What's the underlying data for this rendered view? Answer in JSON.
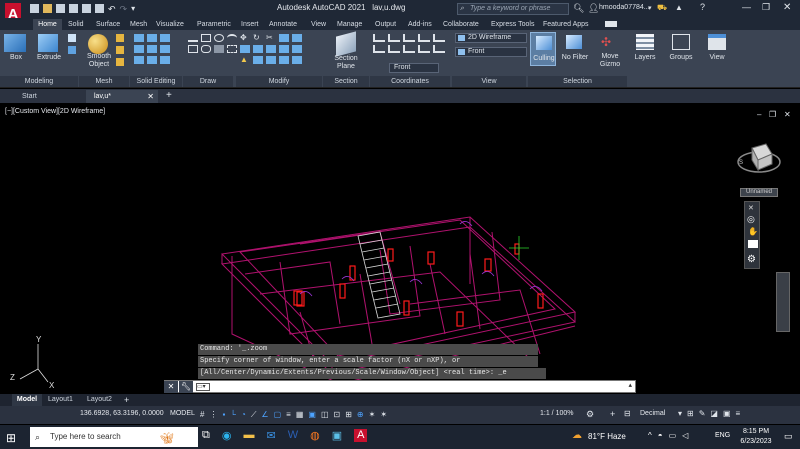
{
  "app": {
    "title": "Autodesk AutoCAD 2021",
    "file": "lav,u.dwg",
    "search_placeholder": "Type a keyword or phrase",
    "user": "hmooda07784...",
    "logo_letter": "A"
  },
  "ribbon": {
    "tabs": [
      "Home",
      "Solid",
      "Surface",
      "Mesh",
      "Visualize",
      "Parametric",
      "Insert",
      "Annotate",
      "View",
      "Manage",
      "Output",
      "Add-ins",
      "Collaborate",
      "Express Tools",
      "Featured Apps"
    ],
    "active_tab": "Home",
    "panels": {
      "modeling": "Modeling",
      "mesh": "Mesh",
      "solid_editing": "Solid Editing",
      "draw": "Draw",
      "modify": "Modify",
      "section": "Section",
      "coordinates": "Coordinates",
      "view": "View",
      "selection": "Selection"
    },
    "buttons": {
      "box": "Box",
      "extrude": "Extrude",
      "smooth_object": "Smooth Object",
      "section_plane": "Section Plane",
      "culling": "Culling",
      "no_filter": "No Filter",
      "move_gizmo": "Move Gizmo",
      "layers": "Layers",
      "groups": "Groups",
      "view": "View"
    },
    "visual_style": "2D Wireframe",
    "view_dropdown": "Front",
    "ucs_dropdown": "Front"
  },
  "doc_tabs": {
    "start": "Start",
    "current": "lav,u*"
  },
  "viewport": {
    "label": "[−][Custom View][2D Wireframe]",
    "viewcube_label": "Unnamed"
  },
  "command": {
    "history": [
      "Command: '_.zoom",
      "Specify corner of window, enter a scale factor (nX or nXP), or",
      "[All/Center/Dynamic/Extents/Previous/Scale/Window/Object] <real time>: _e"
    ],
    "input_value": ""
  },
  "layout_tabs": [
    "Model",
    "Layout1",
    "Layout2"
  ],
  "statusbar": {
    "coords": "136.6928, 63.3196, 0.0000",
    "mode": "MODEL",
    "scale": "1:1 / 100%",
    "units": "Decimal"
  },
  "taskbar": {
    "search_placeholder": "Type here to search",
    "weather": "81°F  Haze",
    "language": "ENG",
    "time": "8:15 PM",
    "date": "6/23/2023"
  },
  "colors": {
    "title_bg": "#1f2836",
    "ribbon_bg": "#3b4453",
    "wire_magenta": "#b0126e",
    "wire_red": "#ff1a1a",
    "accent": "#2a7fd4"
  }
}
